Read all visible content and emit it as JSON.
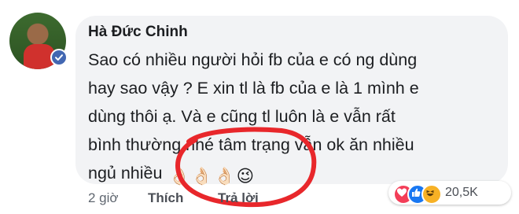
{
  "comment": {
    "author": "Hà Đức Chinh",
    "lines": [
      "Sao có nhiều người hỏi fb của e có ng dùng",
      "hay sao vậy ? E xin tl là fb của e là 1 mình e",
      "dùng thôi ạ. Và e cũng tl luôn là e vẫn rất",
      "bình thường nhé tâm trạng vẫn ok ăn nhiều",
      "ngủ nhiều"
    ],
    "emojis": [
      "👌🏻",
      "👌🏻",
      "👌🏻",
      "😉"
    ]
  },
  "footer": {
    "time": "2 giờ",
    "like_label": "Thích",
    "reply_label": "Trả lời"
  },
  "reactions": {
    "icons": [
      "love-icon",
      "like-icon",
      "haha-icon"
    ],
    "count": "20,5K"
  },
  "colors": {
    "bubble": "#f2f3f5",
    "annotation_red": "#e8272b",
    "verified": "#4267b2"
  }
}
